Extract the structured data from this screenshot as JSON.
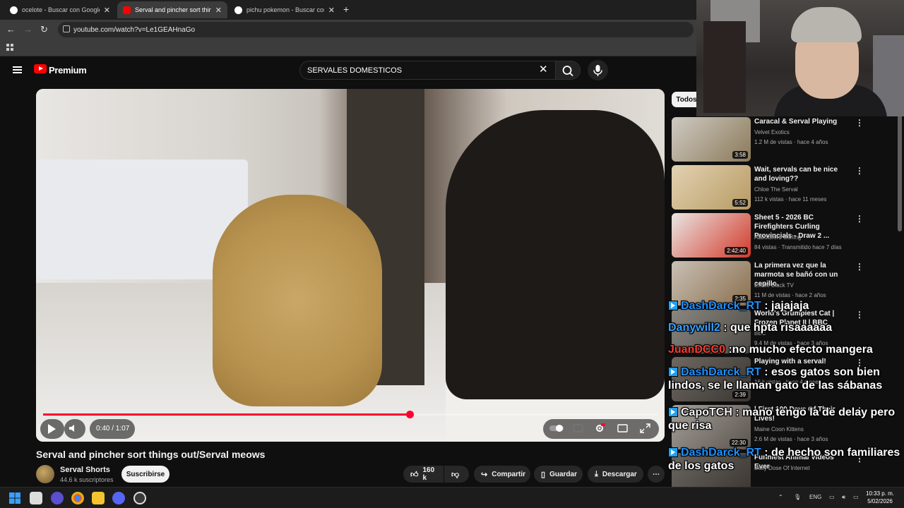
{
  "browser": {
    "tabs": [
      {
        "label": "ocelote - Buscar con Google",
        "active": false,
        "favicon": "google-icon"
      },
      {
        "label": "Serval and pincher sort things out/Serval meows",
        "active": true,
        "favicon": "youtube-icon"
      },
      {
        "label": "pichu pokemon - Buscar con Google",
        "active": false,
        "favicon": "google-icon"
      }
    ],
    "new_tab": "+",
    "url": "youtube.com/watch?v=Le1GEAHnaGo"
  },
  "youtube": {
    "brand": "Premium",
    "search_value": "SERVALES DOMESTICOS"
  },
  "player": {
    "time": "0:40 / 1:07",
    "progress_fraction": 0.597
  },
  "video": {
    "title": "Serval and pincher sort things out/Serval meows",
    "channel": "Serval Shorts",
    "subscribers": "44.6 k suscriptores",
    "subscribe_label": "Suscribirse",
    "likes": "160 k",
    "share_label": "Compartir",
    "save_label": "Guardar",
    "download_label": "Descargar"
  },
  "sidebar": {
    "chip_all": "Todos",
    "items": [
      {
        "title": "Caracal & Serval Playing",
        "channel": "Velvet Exotics",
        "meta": "1.2 M de vistas · hace 4 años",
        "duration": "3:58",
        "colors": [
          "#cfcac2",
          "#8b7a5a"
        ]
      },
      {
        "title": "Wait, servals can be nice and loving??",
        "channel": "Chloe The Serval",
        "meta": "112 k vistas · hace 11 meses",
        "duration": "5:52",
        "colors": [
          "#e2d2b2",
          "#b79a62"
        ]
      },
      {
        "title": "Sheet 5 - 2026 BC Firefighters Curling Provincials - Draw 2 ...",
        "channel": "Abbotsford Curling",
        "meta": "84 vistas · Transmitido hace 7 días",
        "duration": "2:42:40",
        "colors": [
          "#e9e6e4",
          "#d23a2a"
        ]
      },
      {
        "title": "La primera vez que la marmota se bañó con un cepillo.",
        "channel": "Exotic Black TV",
        "meta": "11 M de vistas · hace 2 años",
        "duration": "2:35",
        "colors": [
          "#c9c0b5",
          "#8a6f4e"
        ]
      },
      {
        "title": "World's Grumpiest Cat | Frozen Planet II | BBC",
        "channel": "BBC",
        "meta": "9.4 M de vistas · hace 3 años",
        "duration": "",
        "colors": [
          "#8a8680",
          "#4d4a45"
        ]
      },
      {
        "title": "Playing with a serval!",
        "channel": "",
        "meta": "16 k vistas · hace 4 meses",
        "duration": "2:39",
        "colors": [
          "#6e6860",
          "#3a3632"
        ]
      },
      {
        "title": "| First 100 Days Of Their Lives!",
        "channel": "Maine Coon Kittens",
        "meta": "2.6 M de vistas · hace 3 años",
        "duration": "22:30",
        "colors": [
          "#a6a09a",
          "#5c554f"
        ]
      },
      {
        "title": "Funniest Animal Videos Ever",
        "channel": "Daily Dose Of Internet",
        "meta": "",
        "duration": "",
        "colors": [
          "#6a6660",
          "#3a3530"
        ]
      }
    ]
  },
  "chat": [
    {
      "user": "DashDarck_RT",
      "user_color": "#1e90ff",
      "badge": true,
      "message": " : jajajaja"
    },
    {
      "user": "Danywill2",
      "user_color": "#3aa0ff",
      "badge": false,
      "message": " : que hpta risaaaaaa"
    },
    {
      "user": "JuanDCC0",
      "user_color": "#ff3b30",
      "badge": false,
      "message": " :no mucho efecto mangera"
    },
    {
      "user": "DashDarck_RT",
      "user_color": "#1e90ff",
      "badge": true,
      "message": " : esos gatos son bien lindos, se le llaman gato de las sábanas"
    },
    {
      "user": "CapoTCH",
      "user_color": "#f0f0f0",
      "badge": true,
      "message": " : mano tengo la de delay pero que risa"
    },
    {
      "user": "DashDarck_RT",
      "user_color": "#1e90ff",
      "badge": true,
      "message": " : de hecho son familiares de los gatos"
    }
  ],
  "taskbar": {
    "lang": "ENG",
    "time": "10:33 p. m.",
    "date": "5/02/2026"
  },
  "colors": {
    "youtube_red": "#ff0000",
    "progress_red": "#ff0033",
    "background": "#0f0f0f"
  }
}
